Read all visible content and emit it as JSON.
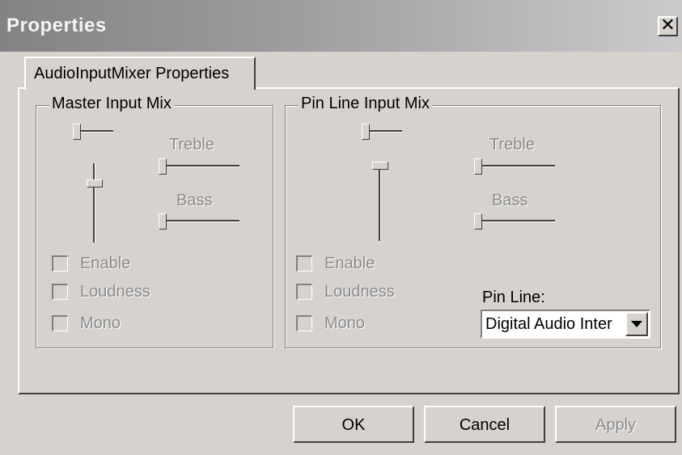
{
  "window": {
    "title": "Properties",
    "close_glyph": "✕"
  },
  "tab": {
    "label": "AudioInputMixer Properties"
  },
  "master": {
    "legend": "Master Input Mix",
    "treble_label": "Treble",
    "bass_label": "Bass",
    "volume_level": 0.3,
    "balance_level": 0.05,
    "treble_level": 0.0,
    "bass_level": 0.0,
    "checkboxes": [
      {
        "label": "Enable",
        "checked": false
      },
      {
        "label": "Loudness",
        "checked": false
      },
      {
        "label": "Mono",
        "checked": false
      }
    ]
  },
  "pinline": {
    "legend": "Pin Line Input Mix",
    "treble_label": "Treble",
    "bass_label": "Bass",
    "volume_level": 0.0,
    "balance_level": 0.05,
    "treble_level": 0.0,
    "bass_level": 0.0,
    "checkboxes": [
      {
        "label": "Enable",
        "checked": false
      },
      {
        "label": "Loudness",
        "checked": false
      },
      {
        "label": "Mono",
        "checked": false
      }
    ],
    "pin_line_label": "Pin Line:",
    "pin_line_value": "Digital Audio Inter"
  },
  "buttons": {
    "ok": "OK",
    "cancel": "Cancel",
    "apply": "Apply"
  },
  "icons": {
    "close": "close-icon",
    "dropdown": "chevron-down-icon"
  }
}
